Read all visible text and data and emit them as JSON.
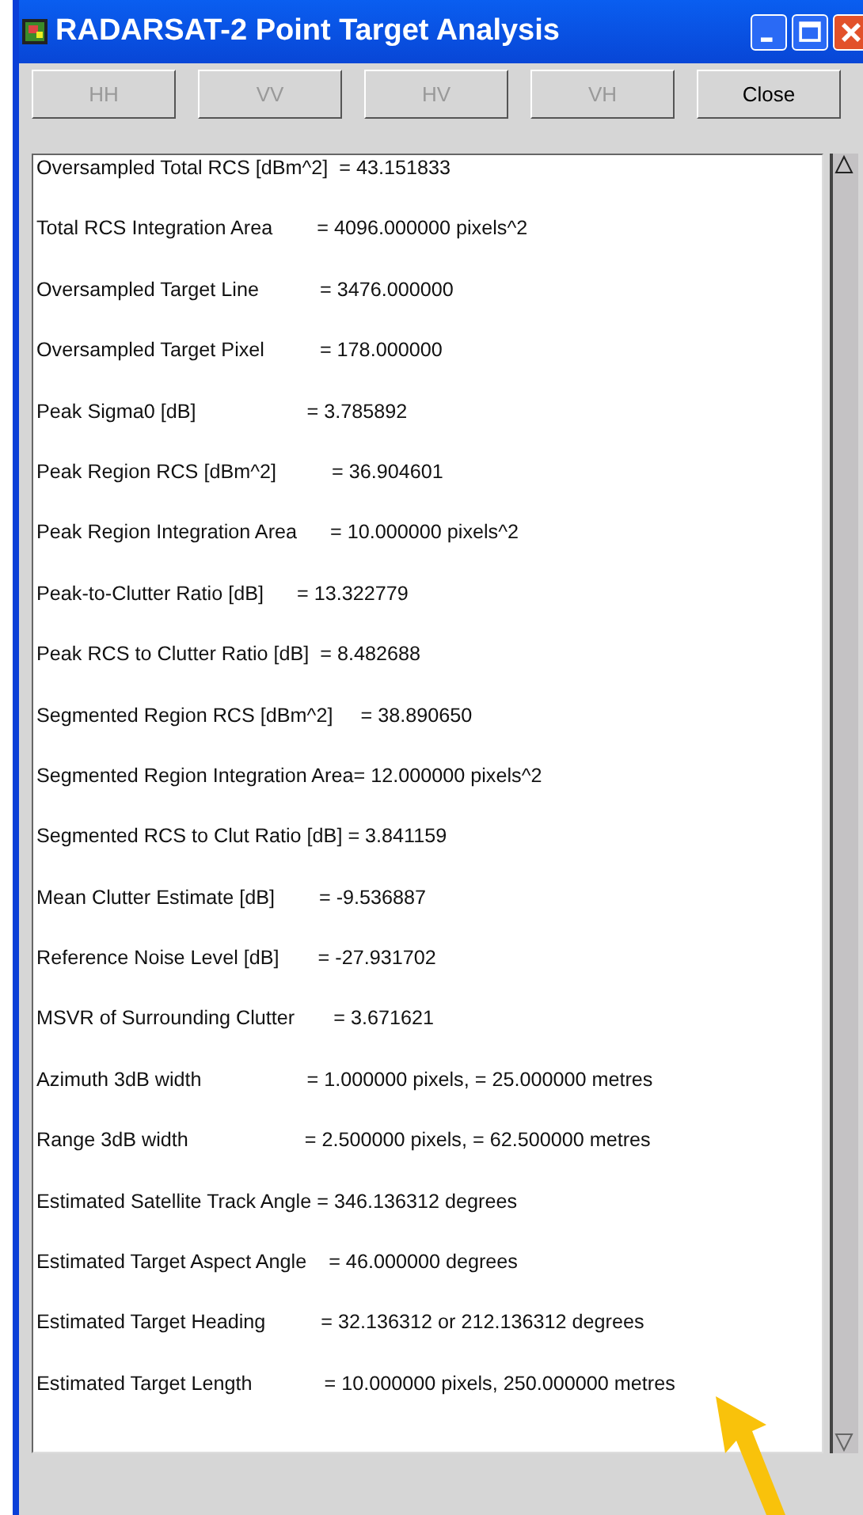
{
  "window": {
    "title": "RADARSAT-2 Point Target Analysis"
  },
  "buttons": [
    {
      "label": "HH",
      "disabled": true
    },
    {
      "label": "VV",
      "disabled": true
    },
    {
      "label": "HV",
      "disabled": true
    },
    {
      "label": "VH",
      "disabled": true
    },
    {
      "label": "Close",
      "disabled": false
    }
  ],
  "report_lines": [
    "Oversampled Total RCS [dBm^2]  = 43.151833",
    "Total RCS Integration Area        = 4096.000000 pixels^2",
    "Oversampled Target Line           = 3476.000000",
    "Oversampled Target Pixel          = 178.000000",
    "Peak Sigma0 [dB]                    = 3.785892",
    "Peak Region RCS [dBm^2]          = 36.904601",
    "Peak Region Integration Area      = 10.000000 pixels^2",
    "Peak-to-Clutter Ratio [dB]      = 13.322779",
    "Peak RCS to Clutter Ratio [dB]  = 8.482688",
    "Segmented Region RCS [dBm^2]     = 38.890650",
    "Segmented Region Integration Area= 12.000000 pixels^2",
    "Segmented RCS to Clut Ratio [dB] = 3.841159",
    "Mean Clutter Estimate [dB]        = -9.536887",
    "Reference Noise Level [dB]       = -27.931702",
    "MSVR of Surrounding Clutter       = 3.671621",
    "Azimuth 3dB width                   = 1.000000 pixels, = 25.000000 metres",
    "Range 3dB width                     = 2.500000 pixels, = 62.500000 metres",
    "Estimated Satellite Track Angle = 346.136312 degrees",
    "Estimated Target Aspect Angle    = 46.000000 degrees",
    "Estimated Target Heading          = 32.136312 or 212.136312 degrees",
    "Estimated Target Length             = 10.000000 pixels, 250.000000 metres"
  ]
}
